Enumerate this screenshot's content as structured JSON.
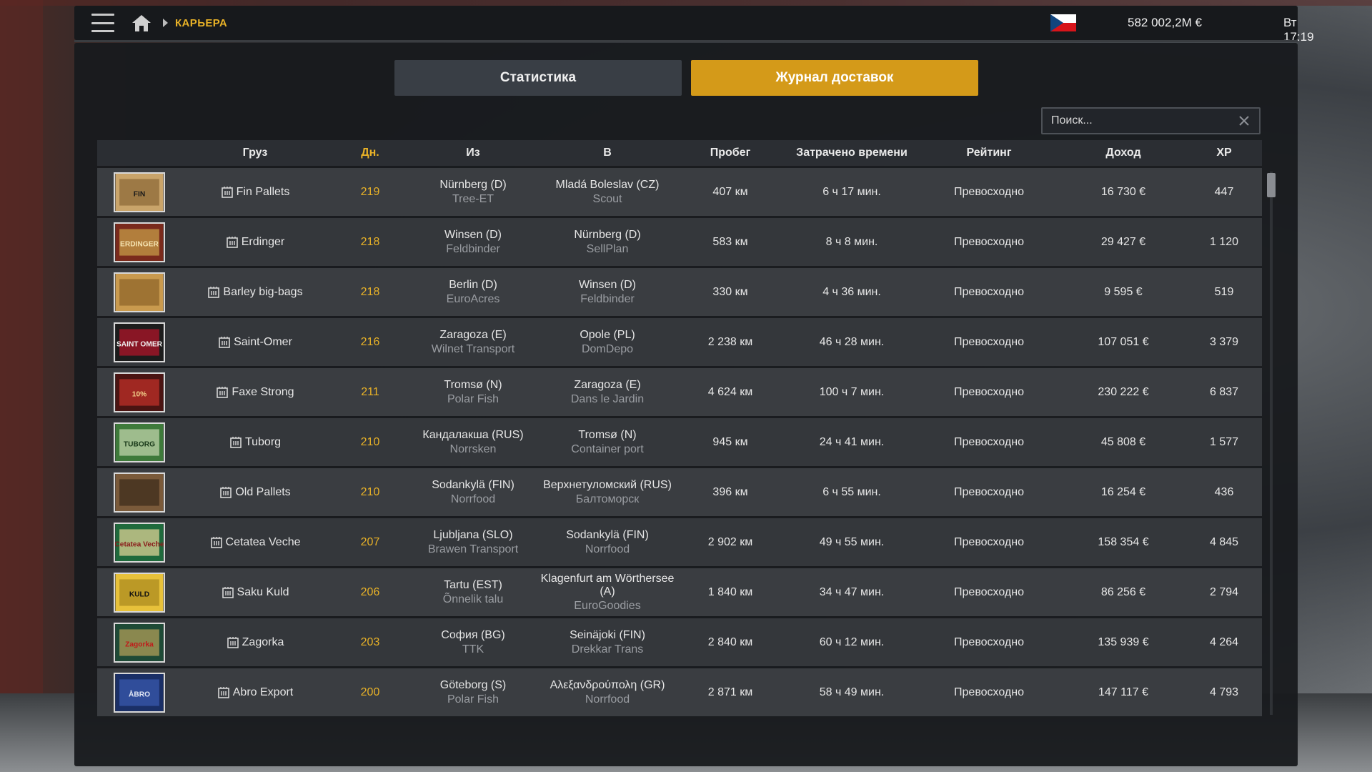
{
  "topbar": {
    "breadcrumb": "КАРЬЕРА",
    "money": "582 002,2M €",
    "clock": "Вт 17:19"
  },
  "tabs": {
    "stats": "Статистика",
    "log": "Журнал доставок"
  },
  "search": {
    "placeholder": "Поиск..."
  },
  "colors": {
    "accent": "#d49a19",
    "crumb": "#e9b227"
  },
  "table": {
    "headers": [
      "Груз",
      "Дн.",
      "Из",
      "В",
      "Пробег",
      "Затрачено времени",
      "Рейтинг",
      "Доход",
      "XP"
    ],
    "rows": [
      {
        "cargo": "Fin Pallets",
        "days": "219",
        "from_city": "Nürnberg (D)",
        "from_company": "Tree-ET",
        "to_city": "Mladá Boleslav (CZ)",
        "to_company": "Scout",
        "distance": "407 км",
        "time": "6 ч 17 мин.",
        "rating": "Превосходно",
        "income": "16 730 €",
        "xp": "447",
        "thumb": "pallets",
        "thumb_text": "FIN"
      },
      {
        "cargo": "Erdinger",
        "days": "218",
        "from_city": "Winsen (D)",
        "from_company": "Feldbinder",
        "to_city": "Nürnberg (D)",
        "to_company": "SellPlan",
        "distance": "583 км",
        "time": "8 ч 8 мин.",
        "rating": "Превосходно",
        "income": "29 427 €",
        "xp": "1 120",
        "thumb": "beer-label",
        "thumb_text": "ERDINGER"
      },
      {
        "cargo": "Barley big-bags",
        "days": "218",
        "from_city": "Berlin (D)",
        "from_company": "EuroAcres",
        "to_city": "Winsen (D)",
        "to_company": "Feldbinder",
        "distance": "330 км",
        "time": "4 ч 36 мин.",
        "rating": "Превосходно",
        "income": "9 595 €",
        "xp": "519",
        "thumb": "grain",
        "thumb_text": ""
      },
      {
        "cargo": "Saint-Omer",
        "days": "216",
        "from_city": "Zaragoza (E)",
        "from_company": "Wilnet Transport",
        "to_city": "Opole (PL)",
        "to_company": "DomDepo",
        "distance": "2 238 км",
        "time": "46 ч 28 мин.",
        "rating": "Превосходно",
        "income": "107 051 €",
        "xp": "3 379",
        "thumb": "beer-label-dark",
        "thumb_text": "SAINT OMER"
      },
      {
        "cargo": "Faxe Strong",
        "days": "211",
        "from_city": "Tromsø (N)",
        "from_company": "Polar Fish",
        "to_city": "Zaragoza (E)",
        "to_company": "Dans le Jardin",
        "distance": "4 624 км",
        "time": "100 ч 7 мин.",
        "rating": "Превосходно",
        "income": "230 222 €",
        "xp": "6 837",
        "thumb": "beer-label-red",
        "thumb_text": "10%"
      },
      {
        "cargo": "Tuborg",
        "days": "210",
        "from_city": "Кандалакша (RUS)",
        "from_company": "Norrsken",
        "to_city": "Tromsø (N)",
        "to_company": "Container port",
        "distance": "945 км",
        "time": "24 ч 41 мин.",
        "rating": "Превосходно",
        "income": "45 808 €",
        "xp": "1 577",
        "thumb": "beer-label-green",
        "thumb_text": "TUBORG"
      },
      {
        "cargo": "Old Pallets",
        "days": "210",
        "from_city": "Sodankylä (FIN)",
        "from_company": "Norrfood",
        "to_city": "Верхнетуломский (RUS)",
        "to_company": "Балтоморск",
        "distance": "396 км",
        "time": "6 ч 55 мин.",
        "rating": "Превосходно",
        "income": "16 254 €",
        "xp": "436",
        "thumb": "old-pallets",
        "thumb_text": ""
      },
      {
        "cargo": "Cetatea Veche",
        "days": "207",
        "from_city": "Ljubljana (SLO)",
        "from_company": "Brawen Transport",
        "to_city": "Sodankylä (FIN)",
        "to_company": "Norrfood",
        "distance": "2 902 км",
        "time": "49 ч 55 мин.",
        "rating": "Превосходно",
        "income": "158 354 €",
        "xp": "4 845",
        "thumb": "beer-label-gold",
        "thumb_text": "Cetatea Veche"
      },
      {
        "cargo": "Saku Kuld",
        "days": "206",
        "from_city": "Tartu (EST)",
        "from_company": "Õnnelik talu",
        "to_city": "Klagenfurt am Wörthersee (A)",
        "to_company": "EuroGoodies",
        "distance": "1 840 км",
        "time": "34 ч 47 мин.",
        "rating": "Превосходно",
        "income": "86 256 €",
        "xp": "2 794",
        "thumb": "beer-label-yellow",
        "thumb_text": "KULD"
      },
      {
        "cargo": "Zagorka",
        "days": "203",
        "from_city": "София (BG)",
        "from_company": "TTK",
        "to_city": "Seinäjoki (FIN)",
        "to_company": "Drekkar Trans",
        "distance": "2 840 км",
        "time": "60 ч 12 мин.",
        "rating": "Превосходно",
        "income": "135 939 €",
        "xp": "4 264",
        "thumb": "beer-label-zagorka",
        "thumb_text": "Zagorka"
      },
      {
        "cargo": "Abro Export",
        "days": "200",
        "from_city": "Göteborg (S)",
        "from_company": "Polar Fish",
        "to_city": "Αλεξανδρούπολη (GR)",
        "to_company": "Norrfood",
        "distance": "2 871 км",
        "time": "58 ч 49 мин.",
        "rating": "Превосходно",
        "income": "147 117 €",
        "xp": "4 793",
        "thumb": "beer-label-blue",
        "thumb_text": "ÅBRO"
      }
    ]
  }
}
